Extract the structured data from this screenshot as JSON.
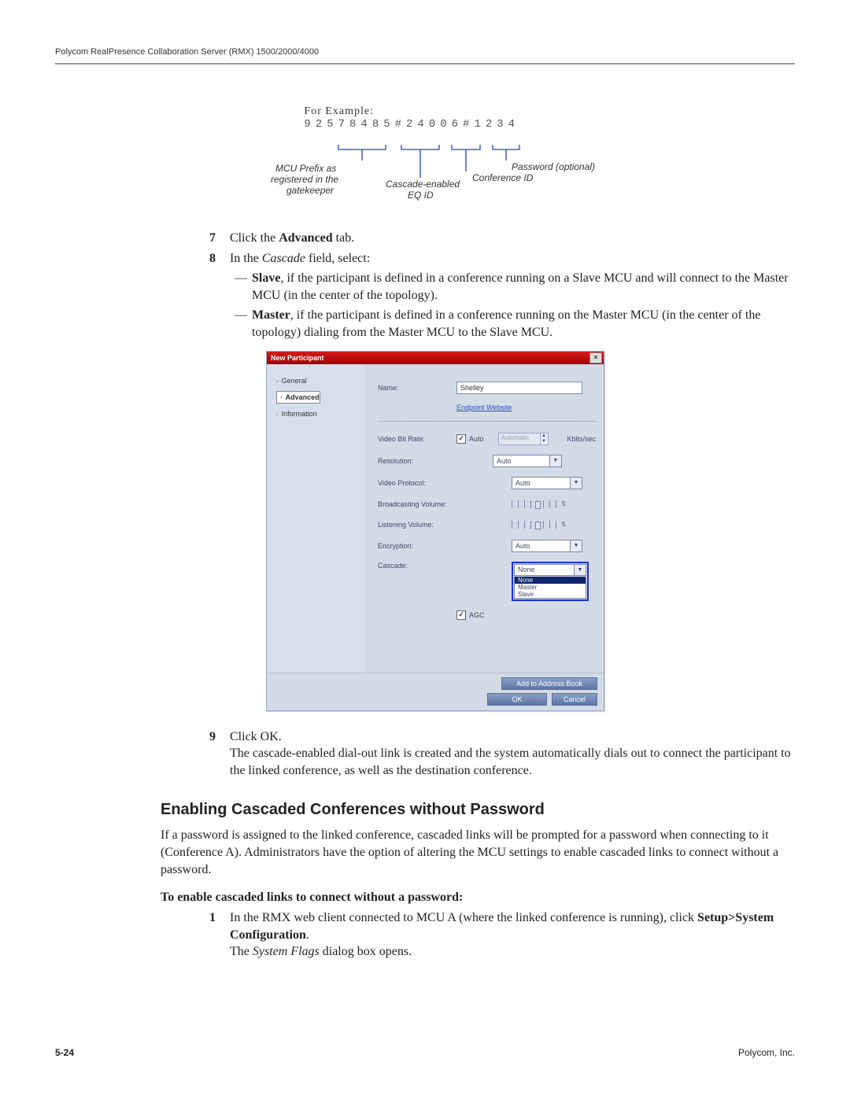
{
  "header": {
    "title": "Polycom RealPresence Collaboration Server (RMX) 1500/2000/4000"
  },
  "example": {
    "label": "For Example:",
    "dial": "92578485#24006#1234",
    "captions": {
      "mcu": "MCU Prefix as registered in the gatekeeper",
      "eq": "Cascade-enabled EQ ID",
      "conf": "Conference ID",
      "pwd": "Password (optional)"
    }
  },
  "steps": {
    "s7": {
      "num": "7",
      "pre": "Click the ",
      "bold": "Advanced",
      "post": " tab."
    },
    "s8": {
      "num": "8",
      "intro_pre": "In the ",
      "intro_it": "Cascade",
      "intro_post": " field, select:",
      "slave_b": "Slave",
      "slave_t": ", if the participant is defined in a conference running on a Slave MCU and will connect to the Master MCU (in the center of the topology).",
      "master_b": "Master",
      "master_t": ", if the participant is defined in a conference running on the Master MCU (in the center of the topology) dialing from the Master MCU to the Slave MCU."
    },
    "s9": {
      "num": "9",
      "l1": "Click OK.",
      "l2": "The cascade-enabled dial-out link is created and the system automatically dials out to connect the participant to the linked conference, as well as the destination conference."
    }
  },
  "dialog": {
    "title": "New Participant",
    "nav": {
      "general": "General",
      "advanced": "Advanced",
      "information": "Information"
    },
    "fields": {
      "name_l": "Name:",
      "name_v": "Shelley",
      "website": "Endpoint Website",
      "vbr_l": "Video Bit Rate:",
      "vbr_chk": "Auto",
      "vbr_disp": "Automatic",
      "vbr_unit": "Kbits/sec",
      "res_l": "Resolution:",
      "res_v": "Auto",
      "vprot_l": "Video Protocol:",
      "vprot_v": "Auto",
      "bvol_l": "Broadcasting Volume:",
      "bvol_v": "5",
      "lvol_l": "Listening Volume:",
      "lvol_v": "5",
      "enc_l": "Encryption:",
      "enc_v": "Auto",
      "casc_l": "Cascade:",
      "casc_v": "None",
      "casc_opts": {
        "none": "None",
        "master": "Master",
        "slave": "Slave"
      },
      "agc": "AGC"
    },
    "buttons": {
      "addr": "Add to Address Book",
      "ok": "OK",
      "cancel": "Cancel"
    }
  },
  "section": {
    "heading": "Enabling Cascaded Conferences without Password",
    "p1": "If a password is assigned to the linked conference, cascaded links will be prompted for a password when connecting to it (Conference A). Administrators have the option of altering the MCU settings to enable cascaded links to connect without a password.",
    "lead": "To enable cascaded links to connect without a password:",
    "s1": {
      "num": "1",
      "l1_pre": "In the RMX web client connected to MCU A (where the linked conference is running), click ",
      "l1_b": "Setup>System Configuration",
      "l1_post": ".",
      "l2_pre": "The ",
      "l2_it": "System Flags",
      "l2_post": " dialog box opens."
    }
  },
  "footer": {
    "page": "5-24",
    "company": "Polycom, Inc."
  }
}
